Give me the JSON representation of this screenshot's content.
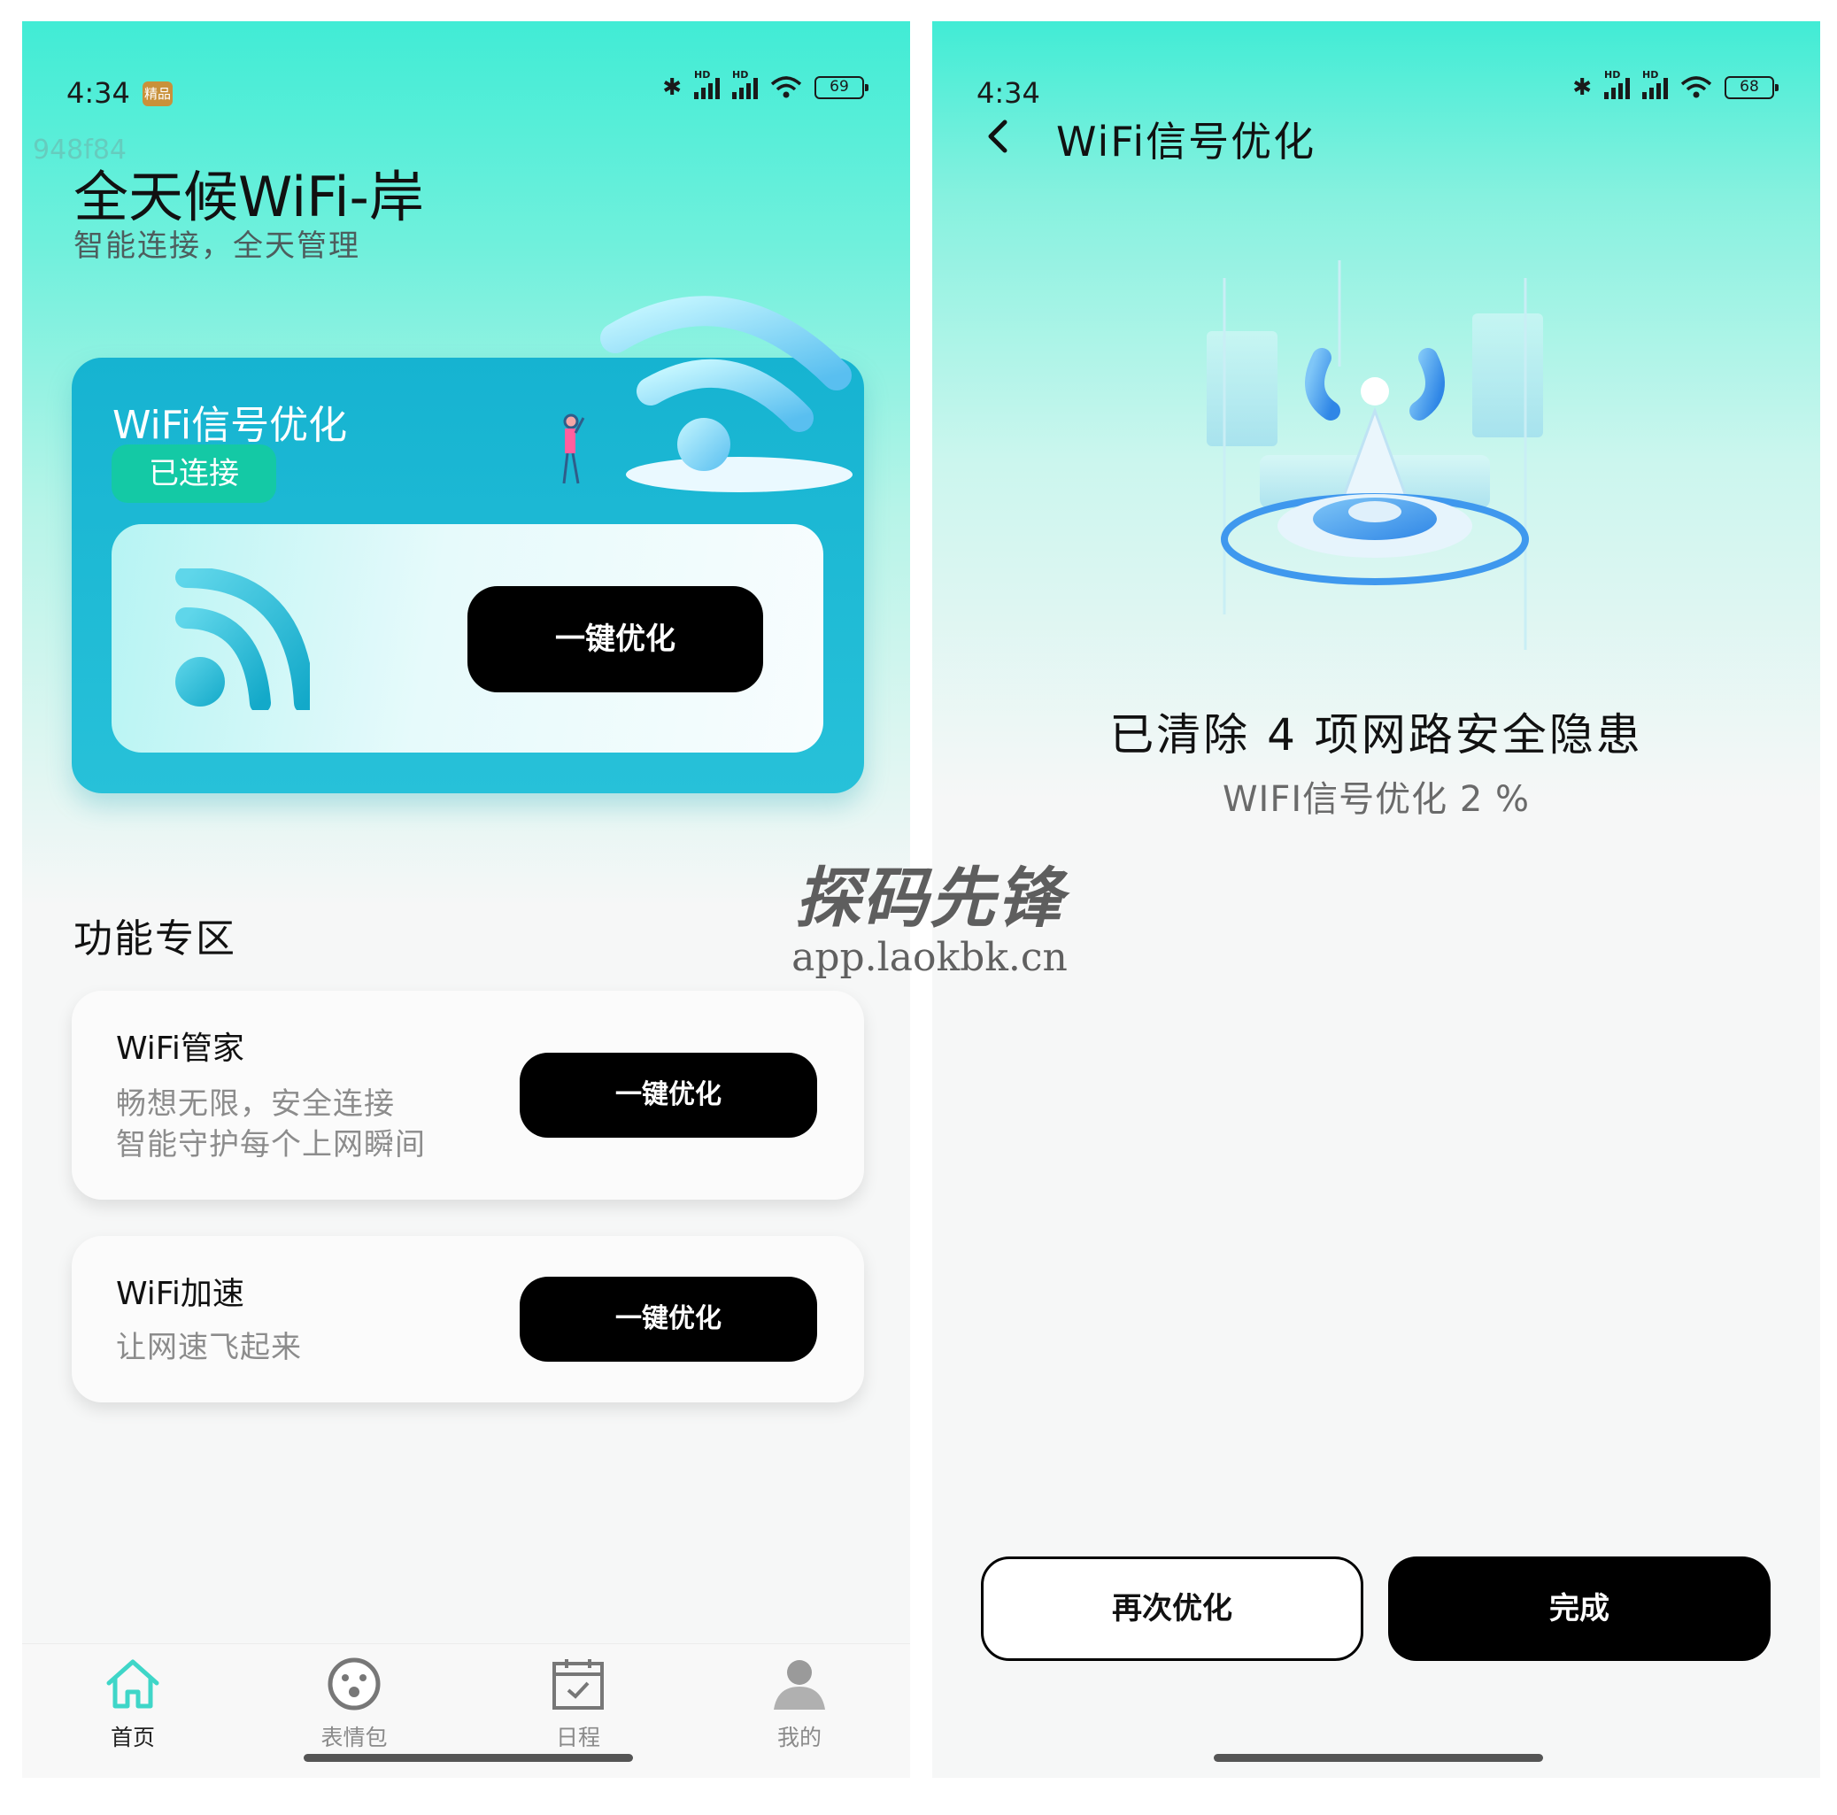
{
  "left": {
    "status": {
      "time": "4:34",
      "badge": "精品",
      "battery": "69"
    },
    "watermark_id": "948f84",
    "app_title": "全天候WiFi-岸",
    "app_subtitle": "智能连接，全天管理",
    "main_card": {
      "title": "WiFi信号优化",
      "status_pill": "已连接",
      "button": "一键优化"
    },
    "section_title": "功能专区",
    "features": [
      {
        "title": "WiFi管家",
        "desc_line1": "畅想无限，安全连接",
        "desc_line2": "智能守护每个上网瞬间",
        "button": "一键优化"
      },
      {
        "title": "WiFi加速",
        "desc_line1": "让网速飞起来",
        "button": "一键优化"
      }
    ],
    "tabs": [
      {
        "label": "首页",
        "icon": "home-icon",
        "active": true
      },
      {
        "label": "表情包",
        "icon": "emoji-icon",
        "active": false
      },
      {
        "label": "日程",
        "icon": "calendar-icon",
        "active": false
      },
      {
        "label": "我的",
        "icon": "profile-icon",
        "active": false
      }
    ]
  },
  "right": {
    "status": {
      "time": "4:34",
      "battery": "68"
    },
    "title": "WiFi信号优化",
    "result_main": "已清除 4 项网路安全隐患",
    "result_sub": "WIFI信号优化 2 %",
    "button_retry": "再次优化",
    "button_done": "完成"
  },
  "watermark": {
    "line1": "探码先锋",
    "line2": "app.laokbk.cn"
  },
  "colors": {
    "accent_teal": "#41ecd5",
    "card_blue": "#16b3d1",
    "pill_green": "#14c9a5",
    "tab_active": "#3fd6c8",
    "button_black": "#000000"
  }
}
